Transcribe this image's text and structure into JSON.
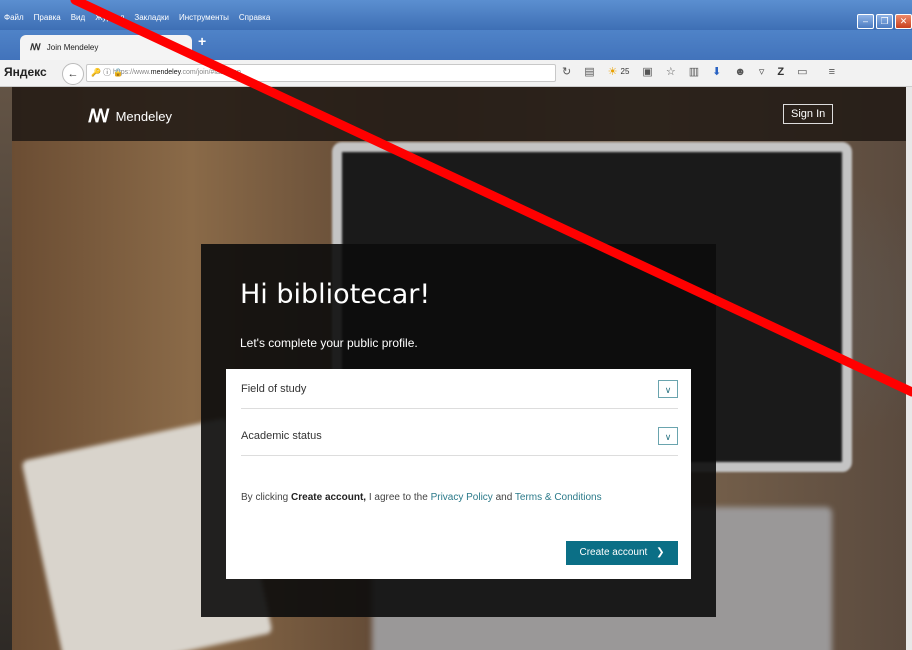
{
  "menubar": {
    "items": [
      "Файл",
      "Правка",
      "Вид",
      "Журнал",
      "Закладки",
      "Инструменты",
      "Справка"
    ]
  },
  "tab": {
    "title": "Join Mendeley"
  },
  "navbar": {
    "brand": "Яндекс",
    "url_prefix": "https://www.",
    "url_domain": "mendeley",
    "url_rest": ".com/join/#last-step",
    "badge_count": "25"
  },
  "header": {
    "brand": "Mendeley",
    "signin_label": "Sign In"
  },
  "form": {
    "greeting": "Hi bibliotecar!",
    "subtitle": "Let's complete your public profile.",
    "field_study": "Field of study",
    "academic_status": "Academic status",
    "terms_prefix": "By clicking",
    "terms_bold": "Create account,",
    "terms_mid": "I agree to the",
    "privacy": "Privacy Policy",
    "and": "and",
    "conditions": "Terms & Conditions",
    "create_label": "Create account"
  },
  "colors": {
    "accent": "#0b6f86",
    "link": "#2b7a8a",
    "annotation_red": "#ff0000"
  }
}
